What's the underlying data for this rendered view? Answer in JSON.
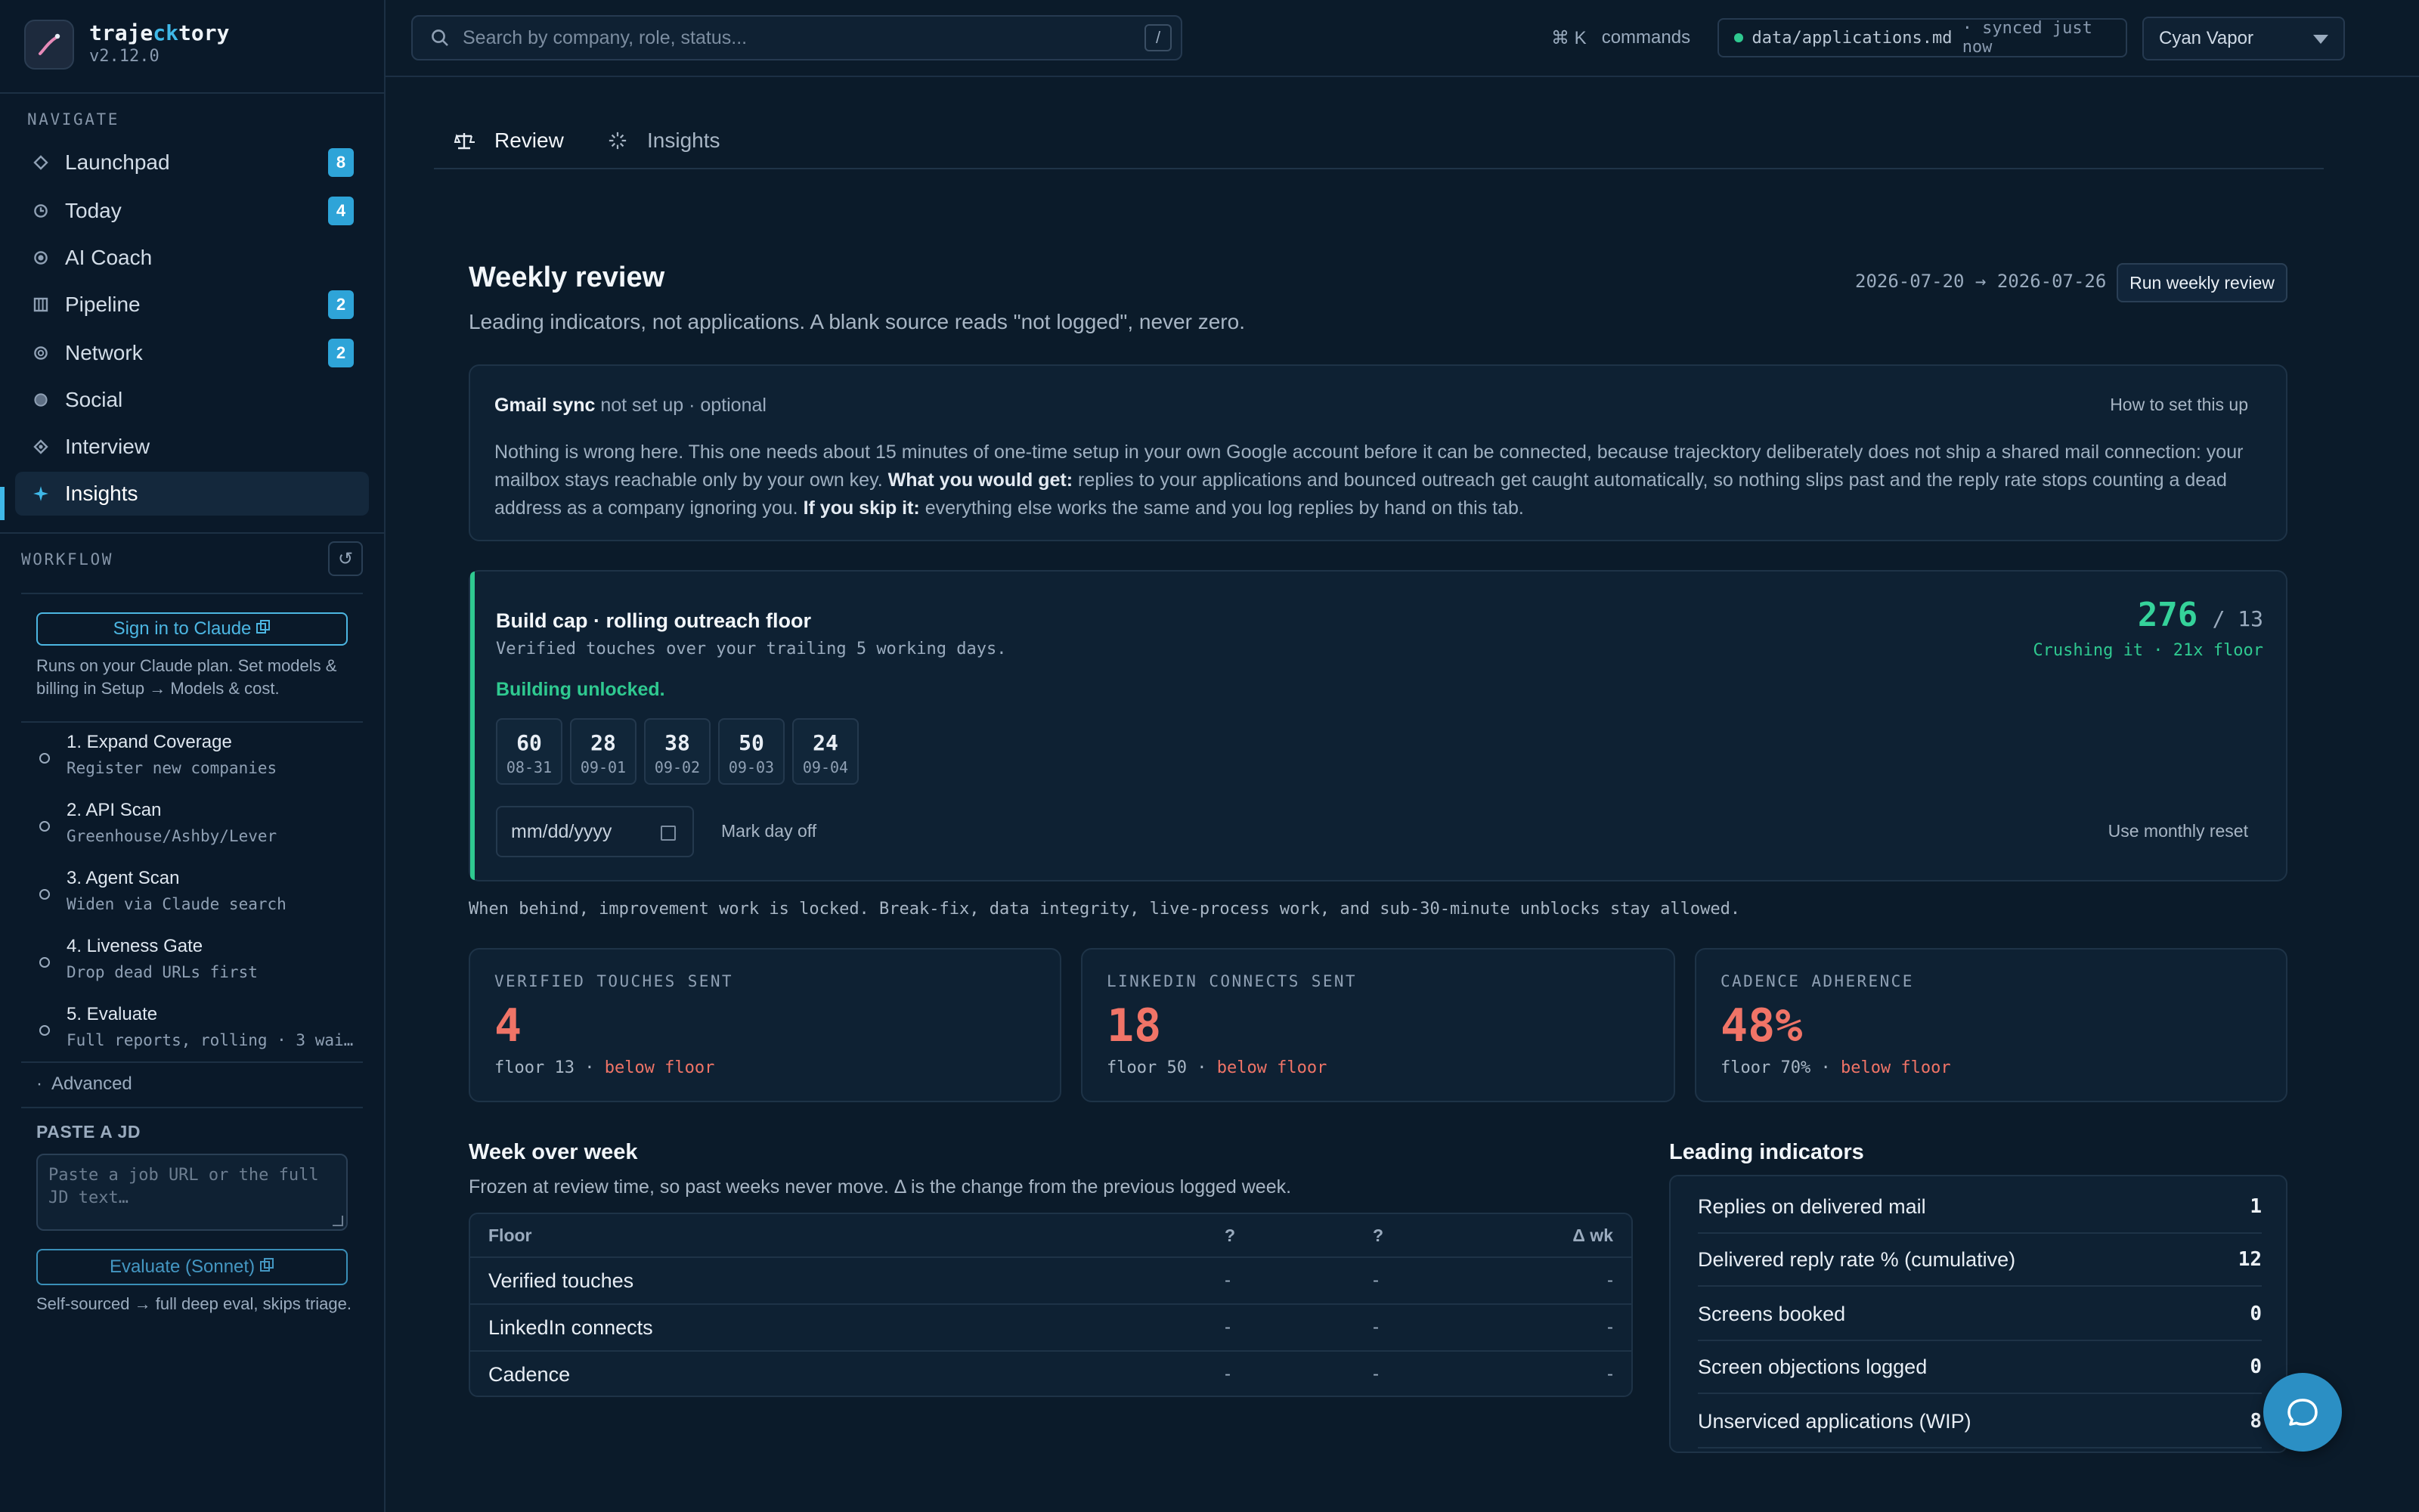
{
  "app": {
    "name_pre": "traje",
    "name_hl": "ck",
    "name_post": "tory",
    "version": "v2.12.0"
  },
  "colors": {
    "accent": "#3fb8e8",
    "success": "#2fc990",
    "danger": "#f07467",
    "background": "#0b1b2a"
  },
  "sidebar": {
    "navigate_label": "NAVIGATE",
    "items": [
      {
        "label": "Launchpad",
        "icon": "diamond-outline-icon",
        "badge": "8"
      },
      {
        "label": "Today",
        "icon": "clock-icon",
        "badge": "4"
      },
      {
        "label": "AI Coach",
        "icon": "target-icon"
      },
      {
        "label": "Pipeline",
        "icon": "columns-icon",
        "badge": "2"
      },
      {
        "label": "Network",
        "icon": "ring-icon",
        "badge": "2"
      },
      {
        "label": "Social",
        "icon": "dot-circle-icon"
      },
      {
        "label": "Interview",
        "icon": "diamond-dot-icon"
      },
      {
        "label": "Insights",
        "icon": "sparkle-icon",
        "active": true
      }
    ],
    "workflow_label": "WORKFLOW",
    "sign_in_label": "Sign in to Claude",
    "claude_note": "Runs on your Claude plan. Set models & billing in Setup → Models & cost.",
    "steps": [
      {
        "title": "1. Expand Coverage",
        "subtitle": "Register new companies"
      },
      {
        "title": "2. API Scan",
        "subtitle": "Greenhouse/Ashby/Lever"
      },
      {
        "title": "3. Agent Scan",
        "subtitle": "Widen via Claude search"
      },
      {
        "title": "4. Liveness Gate",
        "subtitle": "Drop dead URLs first"
      },
      {
        "title": "5. Evaluate",
        "subtitle": "Full reports, rolling · 3 wai…"
      }
    ],
    "advanced_label": "Advanced",
    "paste_label": "PASTE A JD",
    "jd_placeholder": "Paste a job URL or the full JD text…",
    "evaluate_label": "Evaluate (Sonnet)",
    "evaluate_note": "Self-sourced → full deep eval, skips triage."
  },
  "topbar": {
    "search_placeholder": "Search by company, role, status...",
    "search_kbd": "/",
    "cmd_key": "⌘ K",
    "cmd_label": "commands",
    "sync_file": "data/applications.md",
    "sync_status": "· synced just now",
    "theme": "Cyan Vapor"
  },
  "tabs": [
    {
      "label": "Review",
      "icon": "scale-icon",
      "active": true
    },
    {
      "label": "Insights",
      "icon": "burst-icon"
    }
  ],
  "review": {
    "title": "Weekly review",
    "subtitle": "Leading indicators, not applications. A blank source reads \"not logged\", never zero.",
    "date_range": "2026-07-20 → 2026-07-26",
    "run_label": "Run weekly review"
  },
  "gmail": {
    "title": "Gmail sync",
    "status": "not set up · optional",
    "howto": "How to set this up",
    "body_1": "Nothing is wrong here. This one needs about 15 minutes of one-time setup in your own Google account before it can be connected, because trajecktory deliberately does not ship a shared mail connection: your mailbox stays reachable only by your own key. ",
    "body_b1": "What you would get:",
    "body_2": " replies to your applications and bounced outreach get caught automatically, so nothing slips past and the reply rate stops counting a dead address as a company ignoring you. ",
    "body_b2": "If you skip it:",
    "body_3": " everything else works the same and you log replies by hand on this tab."
  },
  "build": {
    "title": "Build cap · rolling outreach floor",
    "subtitle": "Verified touches over your trailing 5 working days.",
    "status": "Building unlocked.",
    "value": "276",
    "floor": "/ 13",
    "verdict": "Crushing it · 21x floor",
    "days": [
      {
        "value": "60",
        "date": "08-31"
      },
      {
        "value": "28",
        "date": "09-01"
      },
      {
        "value": "38",
        "date": "09-02"
      },
      {
        "value": "50",
        "date": "09-03"
      },
      {
        "value": "24",
        "date": "09-04"
      }
    ],
    "date_placeholder": "mm/dd/yyyy",
    "mark_label": "Mark day off",
    "monthly_label": "Use monthly reset"
  },
  "locked_note": "When behind, improvement work is locked. Break-fix, data integrity, live-process work, and sub-30-minute unblocks stay allowed.",
  "stats": [
    {
      "label": "VERIFIED TOUCHES SENT",
      "value": "4",
      "floor": "floor 13 ·",
      "status": "below floor"
    },
    {
      "label": "LINKEDIN CONNECTS SENT",
      "value": "18",
      "floor": "floor 50 ·",
      "status": "below floor"
    },
    {
      "label": "CADENCE ADHERENCE",
      "value": "48%",
      "floor": "floor 70% ·",
      "status": "below floor"
    }
  ],
  "week": {
    "title": "Week over week",
    "subtitle": "Frozen at review time, so past weeks never move. Δ is the change from the previous logged week.",
    "headers": [
      "Floor",
      "?",
      "?",
      "Δ wk"
    ],
    "rows": [
      {
        "label": "Verified touches",
        "a": "-",
        "b": "-",
        "c": "-"
      },
      {
        "label": "LinkedIn connects",
        "a": "-",
        "b": "-",
        "c": "-"
      },
      {
        "label": "Cadence",
        "a": "-",
        "b": "-",
        "c": "-"
      }
    ]
  },
  "leading": {
    "title": "Leading indicators",
    "rows": [
      {
        "label": "Replies on delivered mail",
        "value": "1"
      },
      {
        "label": "Delivered reply rate % (cumulative)",
        "value": "12"
      },
      {
        "label": "Screens booked",
        "value": "0"
      },
      {
        "label": "Screen objections logged",
        "value": "0"
      },
      {
        "label": "Unserviced applications (WIP)",
        "value": "8"
      }
    ]
  }
}
